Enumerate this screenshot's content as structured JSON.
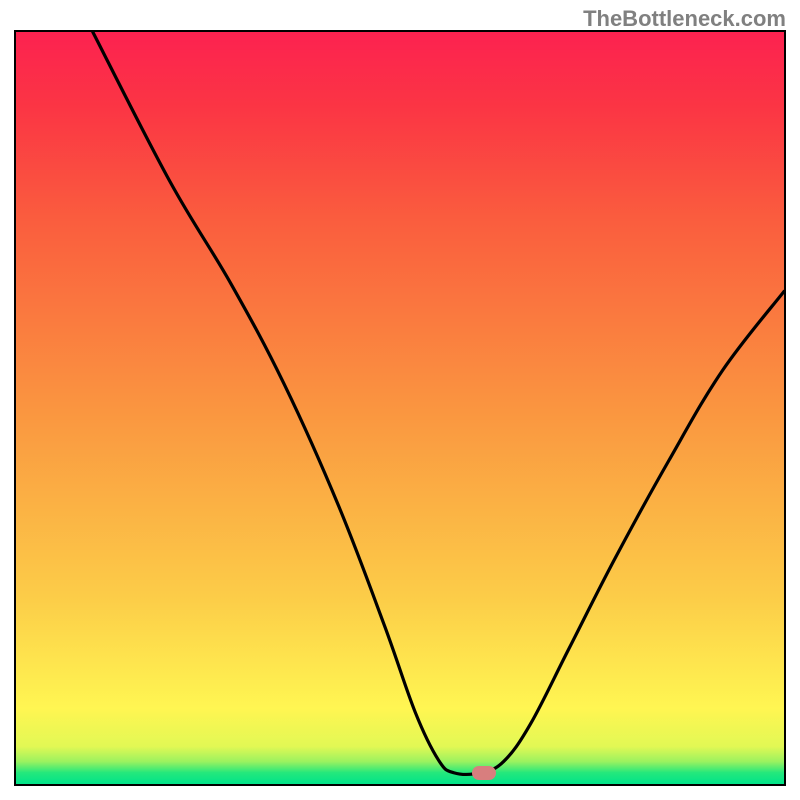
{
  "watermark": "TheBottleneck.com",
  "chart_data": {
    "type": "line",
    "title": "",
    "xlabel": "",
    "ylabel": "",
    "xlim": [
      0,
      100
    ],
    "ylim": [
      0,
      100
    ],
    "gradient": {
      "stops": [
        {
          "pos": 0.0,
          "color": "#00e389"
        },
        {
          "pos": 0.015,
          "color": "#24e87c"
        },
        {
          "pos": 0.03,
          "color": "#9cf25f"
        },
        {
          "pos": 0.05,
          "color": "#e2f854"
        },
        {
          "pos": 0.1,
          "color": "#fff652"
        },
        {
          "pos": 0.25,
          "color": "#fccc48"
        },
        {
          "pos": 0.5,
          "color": "#fa9540"
        },
        {
          "pos": 0.75,
          "color": "#fa5d3e"
        },
        {
          "pos": 0.9,
          "color": "#fb3544"
        },
        {
          "pos": 1.0,
          "color": "#fc2250"
        }
      ]
    },
    "series": [
      {
        "name": "bottleneck-curve",
        "points": [
          {
            "x": 10.0,
            "y": 100.0
          },
          {
            "x": 20.0,
            "y": 80.2
          },
          {
            "x": 28.0,
            "y": 66.5
          },
          {
            "x": 35.0,
            "y": 53.0
          },
          {
            "x": 42.0,
            "y": 37.0
          },
          {
            "x": 48.0,
            "y": 21.0
          },
          {
            "x": 52.0,
            "y": 9.5
          },
          {
            "x": 55.0,
            "y": 3.2
          },
          {
            "x": 57.0,
            "y": 1.5
          },
          {
            "x": 60.5,
            "y": 1.5
          },
          {
            "x": 63.5,
            "y": 3.0
          },
          {
            "x": 67.0,
            "y": 8.0
          },
          {
            "x": 72.0,
            "y": 18.0
          },
          {
            "x": 78.0,
            "y": 30.0
          },
          {
            "x": 85.0,
            "y": 43.0
          },
          {
            "x": 92.0,
            "y": 55.0
          },
          {
            "x": 100.0,
            "y": 65.5
          }
        ]
      }
    ],
    "marker": {
      "x": 61.0,
      "y": 1.5
    }
  }
}
